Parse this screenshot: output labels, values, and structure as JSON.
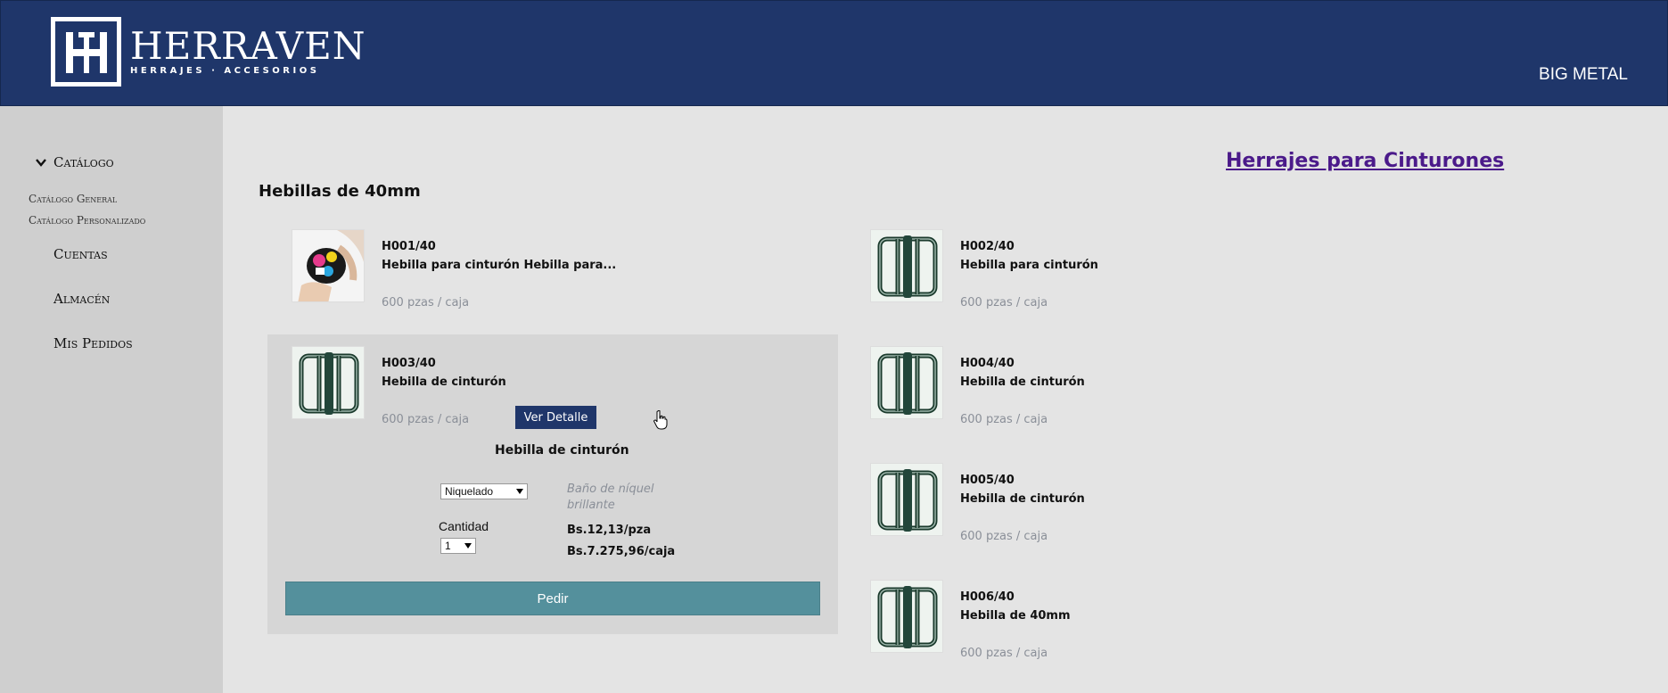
{
  "header": {
    "logo_name": "HERRAVEN",
    "logo_subtitle": "HERRAJES · ACCESORIOS",
    "company": "BIG METAL"
  },
  "sidebar": {
    "catalog_label": "Catálogo",
    "sub_items": [
      "Catálogo General",
      "Catálogo Personalizado"
    ],
    "items": [
      "Cuentas",
      "Almacén",
      "Mis Pedidos"
    ]
  },
  "main": {
    "category_title": "Herrajes para Cinturones",
    "section_title": "Hebillas de 40mm",
    "products": [
      {
        "code": "H001/40",
        "name": "Hebilla para cinturón Hebilla para...",
        "pack": "600 pzas / caja",
        "image": "printed-buckle-photo"
      },
      {
        "code": "H002/40",
        "name": "Hebilla para cinturón",
        "pack": "600 pzas / caja",
        "image": "metal-buckle-icon"
      },
      {
        "code": "H003/40",
        "name": "Hebilla de cinturón",
        "pack": "600 pzas / caja",
        "image": "metal-buckle-icon"
      },
      {
        "code": "H004/40",
        "name": "Hebilla de cinturón",
        "pack": "600 pzas / caja",
        "image": "metal-buckle-icon"
      },
      {
        "code": "H005/40",
        "name": "Hebilla de cinturón",
        "pack": "600 pzas / caja",
        "image": "metal-buckle-icon"
      },
      {
        "code": "H006/40",
        "name": "Hebilla de 40mm",
        "pack": "600 pzas / caja",
        "image": "metal-buckle-icon"
      }
    ],
    "detail": {
      "button_label": "Ver Detalle",
      "name": "Hebilla de cinturón",
      "finish_selected": "Niquelado",
      "finish_description": "Baño de níquel brillante",
      "quantity_label": "Cantidad",
      "quantity_selected": "1",
      "price_unit": "Bs.12,13/pza",
      "price_box": "Bs.7.275,96/caja",
      "order_label": "Pedir"
    }
  },
  "colors": {
    "header_bg": "#1f366a",
    "sidebar_bg": "#cfcfcf",
    "page_bg": "#e4e4e4",
    "order_button": "#54909c",
    "category_link": "#4b1a8a"
  }
}
